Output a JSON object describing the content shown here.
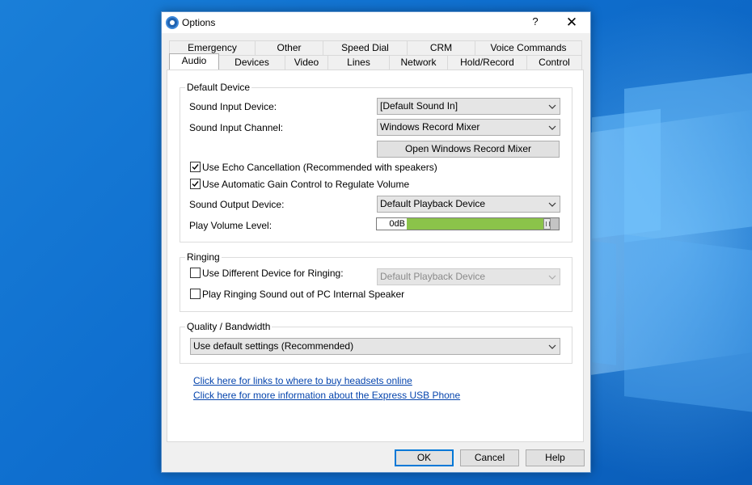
{
  "window": {
    "title": "Options",
    "help_glyph": "?",
    "close_glyph": "✕"
  },
  "tabs_row1": [
    "Emergency",
    "Other",
    "Speed Dial",
    "CRM",
    "Voice Commands"
  ],
  "tabs_row2": [
    "Audio",
    "Devices",
    "Video",
    "Lines",
    "Network",
    "Hold/Record",
    "Control"
  ],
  "active_tab": "Audio",
  "default_device": {
    "group_label": "Default Device",
    "input_device_label": "Sound Input Device:",
    "input_device_value": "[Default Sound In]",
    "input_channel_label": "Sound Input Channel:",
    "input_channel_value": "Windows Record Mixer",
    "open_mixer_button": "Open Windows Record Mixer",
    "echo_cancellation_label": "Use Echo Cancellation (Recommended with speakers)",
    "echo_cancellation_checked": true,
    "agc_label": "Use Automatic Gain Control to Regulate Volume",
    "agc_checked": true,
    "output_device_label": "Sound Output Device:",
    "output_device_value": "Default Playback Device",
    "play_volume_label": "Play Volume Level:",
    "play_volume_value": "0dB",
    "play_volume_fraction": 0.92
  },
  "ringing": {
    "group_label": "Ringing",
    "different_device_label": "Use Different Device for Ringing:",
    "different_device_checked": false,
    "ringing_device_value": "Default Playback Device",
    "pc_speaker_label": "Play Ringing Sound out of PC Internal Speaker",
    "pc_speaker_checked": false
  },
  "quality": {
    "group_label": "Quality / Bandwidth",
    "value": "Use default settings (Recommended)"
  },
  "links": {
    "headsets": "Click here for links to where to buy headsets online",
    "usb_phone": "Click here for more information about the Express USB Phone"
  },
  "buttons": {
    "ok": "OK",
    "cancel": "Cancel",
    "help": "Help"
  },
  "colors": {
    "link": "#0645ad",
    "volume_fill": "#8bc34a",
    "default_button_border": "#0078d7"
  }
}
